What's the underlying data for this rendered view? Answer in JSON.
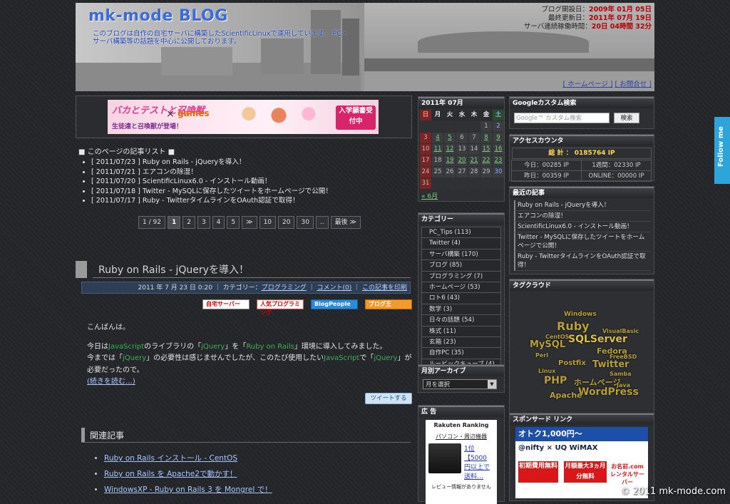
{
  "header": {
    "title": "mk-mode BLOG",
    "description": "このブログは自作の自宅サーバに構築したScientificLinuxで運用しています。 PC・サーバ構築等の話題を中心に公開しております。",
    "stats": [
      {
        "label": "ブログ開設日：",
        "value": "2009年 01月 05日"
      },
      {
        "label": "最終更新日：",
        "value": "2011年 07月 19日"
      },
      {
        "label": "サーバ連続稼働時間：",
        "value": "20日 04時間 32分"
      }
    ],
    "links": [
      "[ ホームページ ]",
      "[ お問合せ ]"
    ]
  },
  "banner": {
    "t1": "バカとテストと召喚獣",
    "cross": "×",
    "games": "games",
    "t2": "生徒達と召喚獣が登場！",
    "cta": "入学願書受付中"
  },
  "article_list": {
    "title": "■ このページの記事リスト ■",
    "items": [
      "[ 2011/07/23 ] Ruby on Rails - jQueryを導入！",
      "[ 2011/07/21 ] エアコンの除湿！",
      "[ 2011/07/20 ] ScientificLinux6.0 - インストール動画！",
      "[ 2011/07/18 ] Twitter - MySQLに保存したツイートをホームページで公開！",
      "[ 2011/07/17 ] Ruby - TwitterタイムラインをOAuth認証で取得！"
    ]
  },
  "pager": {
    "count": "1 / 92",
    "pages": [
      "1",
      "2",
      "3",
      "4",
      "5",
      "≫",
      "10",
      "20",
      "30",
      "..",
      "最後 ≫"
    ]
  },
  "post": {
    "title": "Ruby on Rails - jQueryを導入！",
    "meta_date": "2011 年 7 月 23 日 0:20 ｜ カテゴリー：",
    "meta_category": "プログラミング",
    "meta_sep": "｜",
    "meta_comment": "コメント(0)",
    "meta_print": "この記事を印刷",
    "badges": [
      "自宅サーバー",
      "人気プログラミング",
      "BlogPeople",
      "ブログ王"
    ],
    "greeting": "こんばんは。",
    "p1a": "今日は",
    "p1b": "JavaScript",
    "p1c": "のライブラリの「",
    "p1d": "jQuery",
    "p1e": "」を「",
    "p1f": "Ruby on Rails",
    "p1g": "」環境に導入してみました。",
    "p2a": "今までは「",
    "p2b": "jQuery",
    "p2c": "」の必要性は感じませんでしたが、このたび使用したい",
    "p2d": "JavaScript",
    "p2e": "で「",
    "p2f": "jQuery",
    "p2g": "」が",
    "p3": "必要だったので。",
    "more": "(続きを読む…)",
    "tweet": "ツイートする"
  },
  "related": {
    "title": "関連記事",
    "items": [
      "Ruby on Rails インストール - CentOS",
      "Ruby on Rails を Apache2で動かす！",
      "WindowsXP - Ruby on Rails 3 を Mongrel で！"
    ]
  },
  "calendar": {
    "title": "2011年 07月",
    "weekdays": [
      "日",
      "月",
      "火",
      "水",
      "木",
      "金",
      "土"
    ],
    "cells": [
      "",
      "",
      "",
      "",
      "",
      "1",
      "2",
      "3",
      "4",
      "5",
      "6",
      "7",
      "8",
      "9",
      "10",
      "11",
      "12",
      "13",
      "14",
      "15",
      "16",
      "17",
      "18",
      "19",
      "20",
      "21",
      "22",
      "23",
      "24",
      "25",
      "26",
      "27",
      "28",
      "29",
      "30",
      "31",
      "",
      "",
      "",
      "",
      "",
      ""
    ],
    "prev": "« 6月"
  },
  "categories": {
    "title": "カテゴリー",
    "items": [
      "PC_Tips (113)",
      "Twitter (4)",
      "サーバ構築 (170)",
      "ブログ (85)",
      "プログラミング (7)",
      "ホームページ (53)",
      "ロト6 (43)",
      "数学 (3)",
      "日々の話題 (54)",
      "株式 (11)",
      "玄箱 (23)",
      "自作PC (35)",
      "ルービックキューブ (4)"
    ]
  },
  "archive": {
    "title": "月別アーカイブ",
    "select": "月を選択"
  },
  "ad": {
    "title": "広 告",
    "rakuten_title": "Rakuten Ranking",
    "rakuten_item": "パソコン・周辺機器",
    "rakuten_rank": "1位【5000円以上で送料…",
    "rakuten_review": "レビュー情報がありません"
  },
  "gsearch": {
    "title": "Googleカスタム検索",
    "placeholder": "Google™ カスタム検索",
    "button": "検索"
  },
  "counter": {
    "title": "アクセスカウンタ",
    "total": "総 計 ： 0185764 IP",
    "today": "今日：00285 IP",
    "week": "1週間：02330 IP",
    "yesterday": "昨日：00359 IP",
    "online": "ONLINE：00000 IP"
  },
  "recent": {
    "title": "最近の記事",
    "items": [
      "Ruby on Rails - jQueryを導入！",
      "エアコンの除湿！",
      "ScientificLinux6.0 - インストール動画！",
      "Twitter - MySQLに保存したツイートをホームページで公開！",
      "Ruby - TwitterタイムラインをOAuth認証で取得！"
    ]
  },
  "tagcloud": {
    "title": "タグクラウド",
    "tags": [
      "Windows",
      "Ruby",
      "SQLServer",
      "MySQL",
      "Fedora",
      "Twitter",
      "Postfix",
      "PHP",
      "WordPress",
      "Apache",
      "CentOS",
      "Samba",
      "FreeBSD",
      "Linux",
      "VisualBasic",
      "ホームページ",
      "Perl",
      "Java"
    ]
  },
  "sponsor": {
    "title": "スポンサード リンク",
    "ad1": "オトク1,000円～",
    "ad2": "@nifty × UQ WiMAX",
    "ad3": "初期費用無料",
    "ad4": "月額最大3ヵ月分無料",
    "ad5": "お名前.com レンタルサーバー"
  },
  "follow": "Follow me",
  "copyright": "© 2011 mk-mode.com"
}
